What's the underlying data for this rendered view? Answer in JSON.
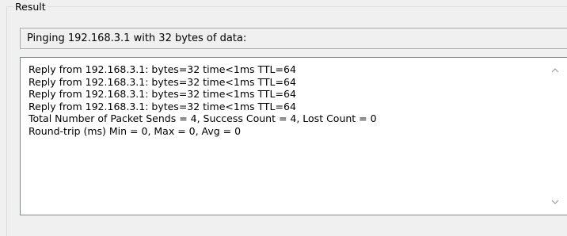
{
  "result_group": {
    "title": "Result"
  },
  "summary": {
    "text": "Pinging 192.168.3.1 with 32 bytes of data:"
  },
  "output": {
    "lines": [
      "Reply from 192.168.3.1: bytes=32 time<1ms TTL=64",
      "Reply from 192.168.3.1: bytes=32 time<1ms TTL=64",
      "Reply from 192.168.3.1: bytes=32 time<1ms TTL=64",
      "Reply from 192.168.3.1: bytes=32 time<1ms TTL=64",
      "Total Number of Packet Sends = 4, Success Count = 4, Lost Count = 0",
      "Round-trip (ms) Min = 0, Max = 0, Avg = 0"
    ]
  },
  "scrollbar": {
    "up_icon": "chevron-up-icon",
    "down_icon": "chevron-down-icon",
    "arrow_color": "#a0a0a0"
  }
}
